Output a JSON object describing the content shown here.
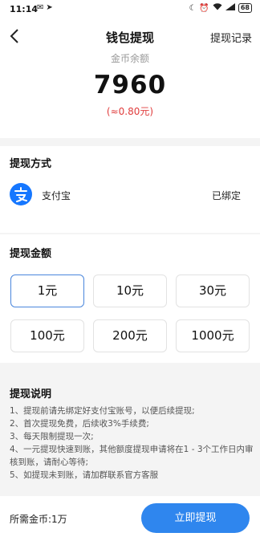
{
  "status_bar": {
    "time": "11:14",
    "battery": "68"
  },
  "header": {
    "title": "钱包提现",
    "right_link": "提现记录"
  },
  "balance": {
    "label": "金币余额",
    "value": "7960",
    "rmb": "(≈0.80元)"
  },
  "method": {
    "title": "提现方式",
    "name": "支付宝",
    "status": "已绑定",
    "brand_color": "#1677ff"
  },
  "amount": {
    "title": "提现金额",
    "options": [
      "1元",
      "10元",
      "30元",
      "100元",
      "200元",
      "1000元"
    ],
    "selected_index": 0
  },
  "description": {
    "title": "提现说明",
    "items": [
      "1、提现前请先绑定好支付宝账号，以便后续提现;",
      "2、首次提现免费，后续收3%手续费;",
      "3、每天限制提现一次;",
      "4、一元提现快速到账，其他额度提现申请将在1 - 3个工作日内审核到账，请耐心等待;",
      "5、如提现未到账，请加群联系官方客服"
    ]
  },
  "footer": {
    "required": "所需金币:1万",
    "button": "立即提现",
    "accent": "#2f86ee"
  }
}
